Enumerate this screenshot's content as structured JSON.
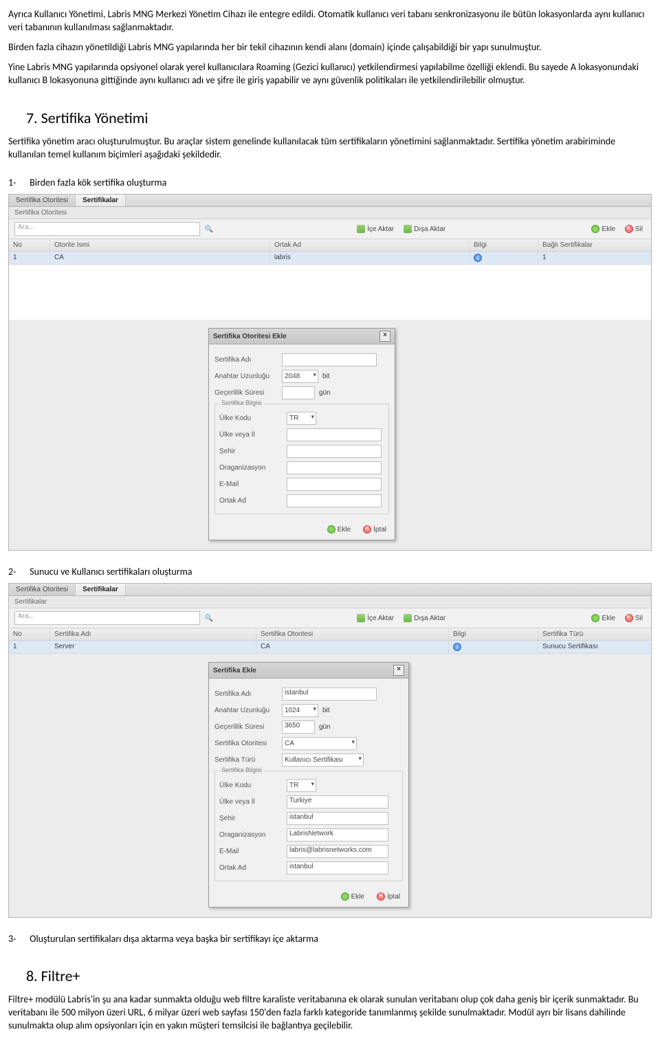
{
  "intro": {
    "p1": "Ayrıca Kullanıcı Yönetimi, Labris MNG Merkezi Yönetim Cihazı ile entegre edildi. Otomatik kullanıcı veri tabanı senkronizasyonu ile bütün lokasyonlarda aynı kullanıcı veri tabanının kullanılması sağlanmaktadır.",
    "p2": "Birden fazla cihazın yönetildiği Labris MNG yapılarında her bir tekil cihazının kendi alanı (domain) içinde çalışabildiği bir yapı sunulmuştur.",
    "p3": "Yine Labris MNG yapılarında opsiyonel olarak yerel kullanıcılara Roaming (Gezici kullanıcı) yetkilendirmesi yapılabilme özelliği eklendi. Bu sayede A lokasyonundaki kullanıcı B lokasyonuna gittiğinde aynı kullanıcı adı ve şifre ile giriş yapabilir ve aynı güvenlik politikaları ile yetkilendirilebilir olmuştur."
  },
  "sec7": {
    "heading": "7. Sertifika Yönetimi",
    "desc": "Sertifika yönetim aracı oluşturulmuştur. Bu araçlar sistem genelinde kullanılacak tüm sertifikaların yönetimini sağlanmaktadır. Sertifika yönetim arabiriminde kullanılan temel kullanım biçimleri aşağıdaki şekildedir.",
    "item1_num": "1-",
    "item1": "Birden fazla kök sertifika oluşturma",
    "item2_num": "2-",
    "item2": "Sunucu ve Kullanıcı sertifikaları oluşturma",
    "item3_num": "3-",
    "item3": "Oluşturulan sertifikaları dışa aktarma veya başka bir sertifikayı içe aktarma"
  },
  "sec8": {
    "heading": "8. Filtre+",
    "desc": "Filtre+ modülü Labris'in şu ana kadar sunmakta olduğu web filtre karaliste veritabanına ek olarak sunulan veritabanı olup çok daha geniş bir içerik sunmaktadır. Bu veritabanı ile 500 milyon üzeri URL, 6 milyar üzeri web sayfası 150'den fazla farklı kategoride tanımlanmış şekilde sunulmaktadır. Modül ayrı bir lisans dahilinde sunulmakta olup  alım opsiyonları için en yakın müşteri temsilcisi ile bağlantıya geçilebilir."
  },
  "common": {
    "search_placeholder": "Ara...",
    "import": "İçe Aktar",
    "export": "Dışa Aktar",
    "add": "Ekle",
    "delete": "Sil",
    "cancel": "İptal"
  },
  "shot1": {
    "tabs": {
      "left": "Sertifika Otoritesi",
      "right": "Sertifikalar"
    },
    "subbar": "Sertifika Otoritesi",
    "cols": {
      "no": "No",
      "auth": "Otorite İsmi",
      "cn": "Ortak Ad",
      "info": "Bilgi",
      "dep": "Bağlı Sertifikalar"
    },
    "row": {
      "no": "1",
      "auth": "CA",
      "cn": "labris",
      "dep": "1"
    },
    "dialog": {
      "title": "Sertifika Otoritesi Ekle",
      "fields": {
        "name": "Sertifika Adı",
        "keylen": "Anahtar Uzunluğu",
        "keylen_val": "2048",
        "bit": "bit",
        "valid": "Geçerlilik Süresi",
        "day": "gün",
        "fieldset": "Sertifika Bilgisi",
        "country": "Ülke Kodu",
        "country_val": "TR",
        "state": "Ülke veya İl",
        "city": "Şehir",
        "org": "Oraganizasyon",
        "email": "E-Mail",
        "cn": "Ortak Ad"
      }
    }
  },
  "shot2": {
    "tabs": {
      "left": "Sertifika Otoritesi",
      "right": "Sertifikalar"
    },
    "subbar": "Sertifikalar",
    "cols": {
      "no": "No",
      "name": "Sertifika Adı",
      "auth": "Sertifika Otoritesi",
      "info": "Bilgi",
      "type": "Sertifika Türü"
    },
    "row": {
      "no": "1",
      "name": "Server",
      "auth": "CA",
      "type": "Sunucu Sertifikası"
    },
    "dialog": {
      "title": "Sertifika Ekle",
      "fields": {
        "name": "Sertifika Adı",
        "name_val": "istanbul",
        "keylen": "Anahtar Uzunluğu",
        "keylen_val": "1024",
        "bit": "bit",
        "valid": "Geçerlilik Süresi",
        "valid_val": "3650",
        "day": "gün",
        "authlabel": "Sertifika Otoritesi",
        "auth_val": "CA",
        "typelabel": "Sertifika Türü",
        "type_val": "Kullanıcı Sertifikası",
        "fieldset": "Sertifika Bilgisi",
        "country": "Ülke Kodu",
        "country_val": "TR",
        "state": "Ülke veya İl",
        "state_val": "Turkiye",
        "city": "Şehir",
        "city_val": "istanbul",
        "org": "Oraganizasyon",
        "org_val": "LabrisNetwork",
        "email": "E-Mail",
        "email_val": "labris@labrisnetworks.com",
        "cn": "Ortak Ad",
        "cn_val": "istanbul"
      }
    }
  }
}
